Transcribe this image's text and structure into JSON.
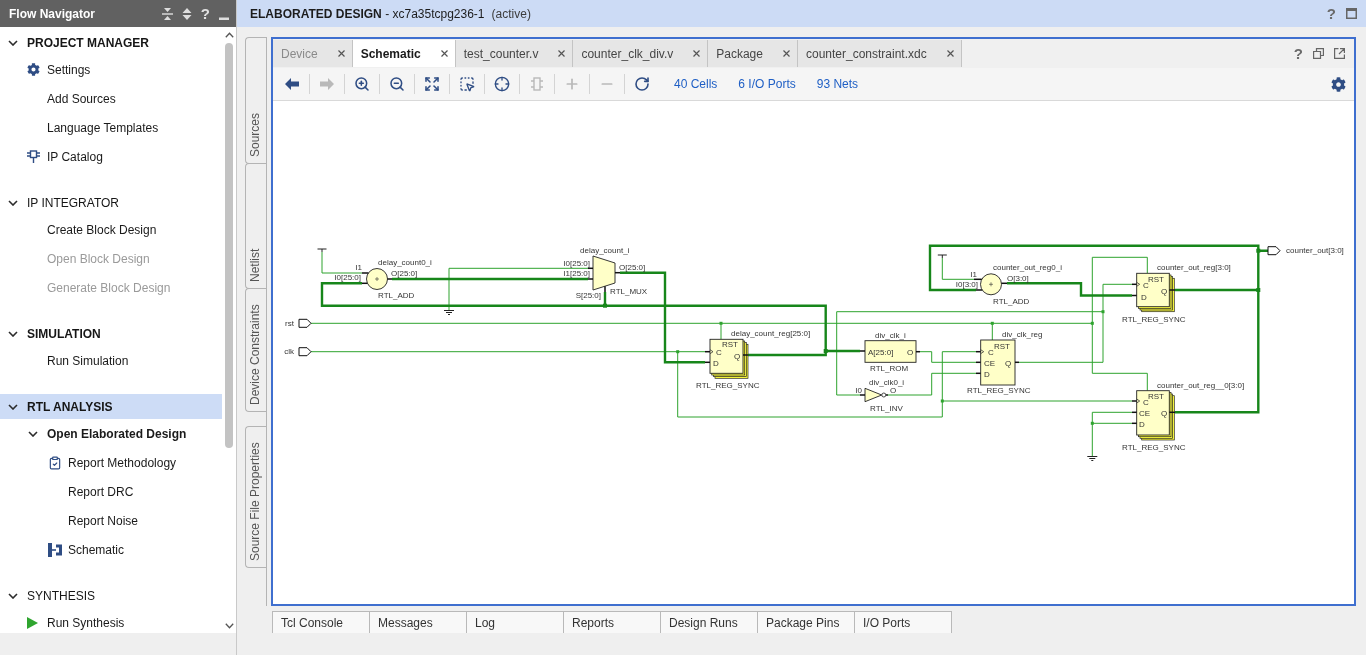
{
  "title_bar": {
    "title": "**ELABORATED DESIGN** - xc7a35tcpg236-1",
    "status": "(active)",
    "help": "?"
  },
  "flow_navigator": {
    "title": "Flow Navigator",
    "help": "?",
    "sections": [
      {
        "label": "PROJECT MANAGER",
        "bold": true,
        "expanded": true,
        "selected": false,
        "items": [
          {
            "label": "Settings",
            "bold": false,
            "disabled": false
          },
          {
            "label": "Add Sources",
            "bold": false,
            "disabled": false
          },
          {
            "label": "Language Templates",
            "bold": false,
            "disabled": false
          },
          {
            "label": "IP Catalog",
            "bold": false,
            "disabled": false
          }
        ]
      },
      {
        "label": "IP INTEGRATOR",
        "bold": false,
        "expanded": true,
        "selected": false,
        "items": [
          {
            "label": "Create Block Design",
            "bold": false,
            "disabled": false
          },
          {
            "label": "Open Block Design",
            "bold": false,
            "disabled": true
          },
          {
            "label": "Generate Block Design",
            "bold": false,
            "disabled": true
          }
        ]
      },
      {
        "label": "SIMULATION",
        "bold": true,
        "expanded": true,
        "selected": false,
        "items": [
          {
            "label": "Run Simulation",
            "bold": false,
            "disabled": false
          }
        ]
      },
      {
        "label": "RTL ANALYSIS",
        "bold": true,
        "expanded": true,
        "selected": true,
        "items": [
          {
            "label": "Open Elaborated Design",
            "bold": true,
            "disabled": false,
            "expanded": true,
            "children": [
              {
                "label": "Report Methodology",
                "bold": false,
                "disabled": false
              },
              {
                "label": "Report DRC",
                "bold": false,
                "disabled": false
              },
              {
                "label": "Report Noise",
                "bold": false,
                "disabled": false
              },
              {
                "label": "Schematic",
                "bold": false,
                "disabled": false
              }
            ]
          }
        ]
      },
      {
        "label": "SYNTHESIS",
        "bold": false,
        "expanded": true,
        "selected": false,
        "items": [
          {
            "label": "Run Synthesis",
            "bold": false,
            "disabled": false
          }
        ]
      }
    ]
  },
  "side_panels": [
    {
      "tabs": [
        {
          "label": "Sources",
          "selected": false
        },
        {
          "label": "Netlist",
          "selected": false
        },
        {
          "label": "Device Constraints",
          "selected": false
        }
      ]
    },
    {
      "tabs": [
        {
          "label": "Source File Properties",
          "selected": false
        }
      ]
    }
  ],
  "editor": {
    "tabs": [
      {
        "label": "Device",
        "selected": false,
        "disabled": true
      },
      {
        "label": "Schematic",
        "selected": true,
        "disabled": false
      },
      {
        "label": "test_counter.v",
        "selected": false,
        "disabled": false
      },
      {
        "label": "counter_clk_div.v",
        "selected": false,
        "disabled": false
      },
      {
        "label": "Package",
        "selected": false,
        "disabled": false
      },
      {
        "label": "counter_constraint.xdc",
        "selected": false,
        "disabled": false
      }
    ],
    "help": "?",
    "toolbar": [
      {
        "disabled": false
      },
      {
        "disabled": true
      },
      {
        "disabled": false
      },
      {
        "disabled": false
      },
      {
        "disabled": false
      },
      {
        "disabled": false
      },
      {
        "disabled": false
      },
      {
        "disabled": true
      },
      {
        "disabled": true
      },
      {
        "disabled": true
      },
      {
        "disabled": false
      }
    ],
    "counts": [
      "40 Cells",
      "6 I/O Ports",
      "93 Nets"
    ],
    "schematic": {
      "ports": [
        {
          "name": "rst",
          "kind": "input"
        },
        {
          "name": "clk",
          "kind": "input"
        },
        {
          "name": "counter_out[3:0]",
          "kind": "output"
        }
      ],
      "cells": [
        {
          "kind": "adder",
          "name": "delay_count0_i",
          "type": "RTL_ADD",
          "pins": [
            "I1",
            "I0[25:0]",
            "O[25:0]"
          ]
        },
        {
          "kind": "mux",
          "name": "delay_count_i",
          "type": "RTL_MUX",
          "pins": [
            "I0[25:0]",
            "I1[25:0]",
            "S[25:0]",
            "O[25:0]"
          ]
        },
        {
          "kind": "register",
          "name": "delay_count_reg[25:0]",
          "type": "RTL_REG_SYNC",
          "stacked": true,
          "pins": [
            "RST",
            "C",
            "Q",
            "D"
          ]
        },
        {
          "kind": "rom",
          "name": "div_clk_i",
          "type": "RTL_ROM",
          "pins": [
            "A[25:0]",
            "O"
          ]
        },
        {
          "kind": "inverter",
          "name": "div_clk0_i",
          "type": "RTL_INV",
          "pins": [
            "I0",
            "O"
          ]
        },
        {
          "kind": "adder",
          "name": "counter_out_reg0_i",
          "type": "RTL_ADD",
          "pins": [
            "I1",
            "I0[3:0]",
            "O[3:0]"
          ]
        },
        {
          "kind": "register",
          "name": "div_clk_reg",
          "type": "RTL_REG_SYNC",
          "stacked": false,
          "pins": [
            "RST",
            "C",
            "CE",
            "Q",
            "D"
          ]
        },
        {
          "kind": "register",
          "name": "counter_out_reg[3:0]",
          "type": "RTL_REG_SYNC",
          "stacked": true,
          "pins": [
            "RST",
            "C",
            "Q",
            "D"
          ]
        },
        {
          "kind": "register",
          "name": "counter_out_reg__0[3:0]",
          "type": "RTL_REG_SYNC",
          "stacked": true,
          "pins": [
            "RST",
            "C",
            "CE",
            "Q",
            "D"
          ]
        }
      ]
    }
  },
  "bottom_tabs": [
    {
      "label": "Tcl Console",
      "selected": false
    },
    {
      "label": "Messages",
      "selected": false
    },
    {
      "label": "Log",
      "selected": false
    },
    {
      "label": "Reports",
      "selected": false
    },
    {
      "label": "Design Runs",
      "selected": false
    },
    {
      "label": "Package Pins",
      "selected": false
    },
    {
      "label": "I/O Ports",
      "selected": false
    }
  ]
}
